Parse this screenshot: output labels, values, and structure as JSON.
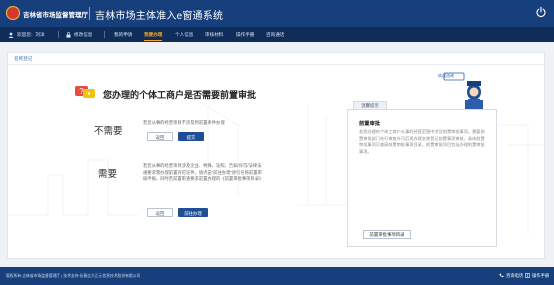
{
  "header": {
    "org_name": "吉林省市场监督管理厅",
    "system_title": "吉林市场主体准入e窗通系统"
  },
  "nav": {
    "welcome": "欢迎您：刘洋",
    "items": [
      {
        "label": "修改信息",
        "icon": "lock-icon"
      },
      {
        "label": "我的申请"
      },
      {
        "label": "我要办理"
      },
      {
        "label": "个人信息"
      },
      {
        "label": "审核材料"
      },
      {
        "label": "操作手册"
      },
      {
        "label": "咨询通话"
      }
    ],
    "active_index": 2
  },
  "breadcrumb": "名称登记",
  "question": "您办理的个体工商户是否需要前置审批",
  "options": {
    "not_required": {
      "label": "不需要",
      "text": "若您从事的经营项目不涉及到前置条件办理",
      "buttons": [
        "返回",
        "提交"
      ]
    },
    "required": {
      "label": "需要",
      "text": "若您从事的经营项目涉及企业、特殊、证照、告知/许可/法律法规要求需办理前置许可证件，请点击“前往办理”进行名称前置审核申报，同时若前置审查要求前置办理的《前置审批事项目录》",
      "buttons": [
        "返回",
        "前往办理"
      ]
    }
  },
  "reminder": {
    "tab": "温馨提示",
    "badge": "欢迎咨询",
    "title": "前置审批",
    "text": "若您办理的个体工商户从事的经营范围中涉及前置审批事项，需要前置审批部门先行审查许可后再办理名称登记前置事项审核，具体前置审批事项可查阅前置审批事项目录。前置审批项目包括办理前置审批事项。",
    "button": "前置审批事项目录"
  },
  "footer": {
    "copyright": "版权所有:吉林省市场监督管理厅 | 技术支持:长春吉大正元信息技术股份有限公司",
    "hotline": "咨询电话",
    "manual": "操作手册"
  },
  "colors": {
    "header_bg": "#173f7c",
    "nav_bg": "#0f2d5a",
    "accent": "#f5a623",
    "primary_button": "#1f4e96"
  }
}
